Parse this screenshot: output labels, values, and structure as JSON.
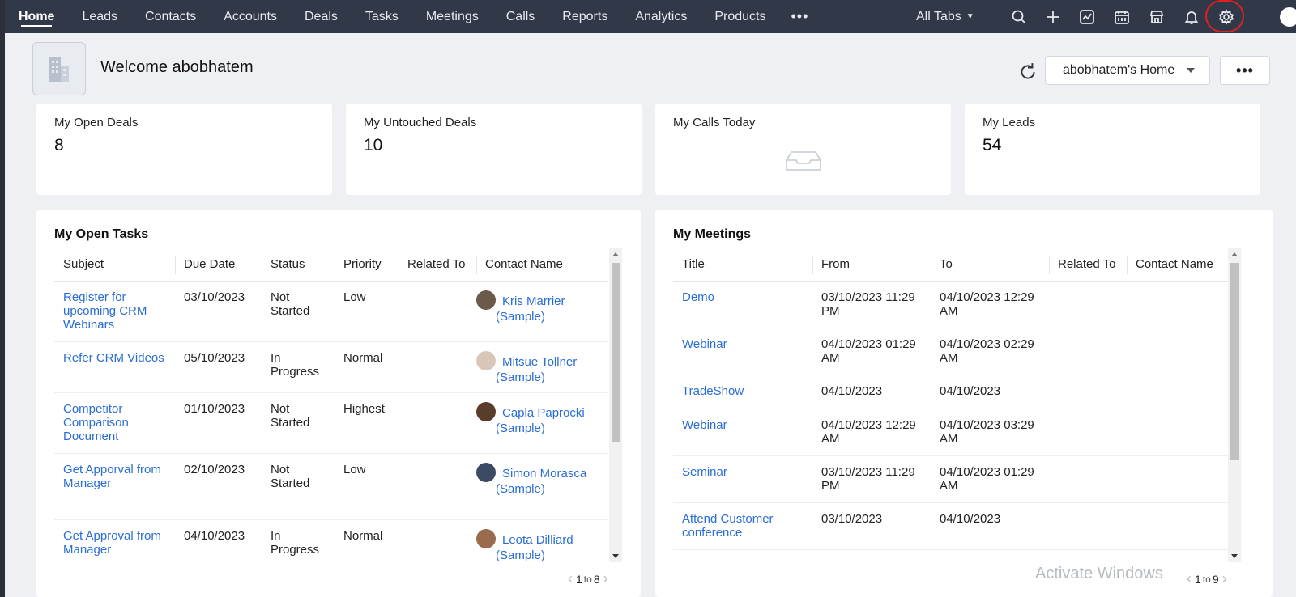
{
  "nav": {
    "tabs": [
      "Home",
      "Leads",
      "Contacts",
      "Accounts",
      "Deals",
      "Tasks",
      "Meetings",
      "Calls",
      "Reports",
      "Analytics",
      "Products"
    ],
    "more": "•••",
    "all_tabs": "All Tabs",
    "icons": [
      "search-icon",
      "plus-icon",
      "signals-icon",
      "calendar-icon",
      "marketplace-icon",
      "bell-icon",
      "gear-icon"
    ]
  },
  "header": {
    "welcome": "Welcome abobhatem",
    "home_selector": "abobhatem's Home",
    "more": "•••"
  },
  "kpis": [
    {
      "title": "My Open Deals",
      "value": "8"
    },
    {
      "title": "My Untouched Deals",
      "value": "10"
    },
    {
      "title": "My Calls Today",
      "value": ""
    },
    {
      "title": "My Leads",
      "value": "54"
    }
  ],
  "tasks": {
    "title": "My Open Tasks",
    "columns": [
      "Subject",
      "Due Date",
      "Status",
      "Priority",
      "Related To",
      "Contact Name"
    ],
    "rows": [
      {
        "subject": "Register for upcoming CRM Webinars",
        "due": "03/10/2023",
        "status": "Not Started",
        "priority": "Low",
        "related": "",
        "contact1": "Kris Marrier",
        "contact2": "(Sample)"
      },
      {
        "subject": "Refer CRM Videos",
        "due": "05/10/2023",
        "status": "In Progress",
        "priority": "Normal",
        "related": "",
        "contact1": "Mitsue Tollner",
        "contact2": "(Sample)"
      },
      {
        "subject": "Competitor Comparison Document",
        "due": "01/10/2023",
        "status": "Not Started",
        "priority": "Highest",
        "related": "",
        "contact1": "Capla Paprocki",
        "contact2": "(Sample)"
      },
      {
        "subject": "Get Apporval from Manager",
        "due": "02/10/2023",
        "status": "Not Started",
        "priority": "Low",
        "related": "",
        "contact1": "Simon Morasca",
        "contact2": "(Sample)"
      },
      {
        "subject": "Get Approval from Manager",
        "due": "04/10/2023",
        "status": "In Progress",
        "priority": "Normal",
        "related": "",
        "contact1": "Leota Dilliard",
        "contact2": "(Sample)"
      }
    ],
    "pager": {
      "from": "1",
      "to_word": "to",
      "to": "8"
    }
  },
  "meetings": {
    "title": "My Meetings",
    "columns": [
      "Title",
      "From",
      "To",
      "Related To",
      "Contact Name"
    ],
    "rows": [
      {
        "title": "Demo",
        "from": "03/10/2023 11:29 PM",
        "to": "04/10/2023 12:29 AM"
      },
      {
        "title": "Webinar",
        "from": "04/10/2023 01:29 AM",
        "to": "04/10/2023 02:29 AM"
      },
      {
        "title": "TradeShow",
        "from": "04/10/2023",
        "to": "04/10/2023"
      },
      {
        "title": "Webinar",
        "from": "04/10/2023 12:29 AM",
        "to": "04/10/2023 03:29 AM"
      },
      {
        "title": "Seminar",
        "from": "03/10/2023 11:29 PM",
        "to": "04/10/2023 01:29 AM"
      },
      {
        "title": "Attend Customer conference",
        "from": "03/10/2023",
        "to": "04/10/2023"
      }
    ],
    "pager": {
      "from": "1",
      "to_word": "to",
      "to": "9"
    }
  },
  "watermark": "Activate Windows",
  "colors": {
    "nav_bg": "#313949",
    "link": "#2a6dd6",
    "highlight": "#e02020"
  }
}
